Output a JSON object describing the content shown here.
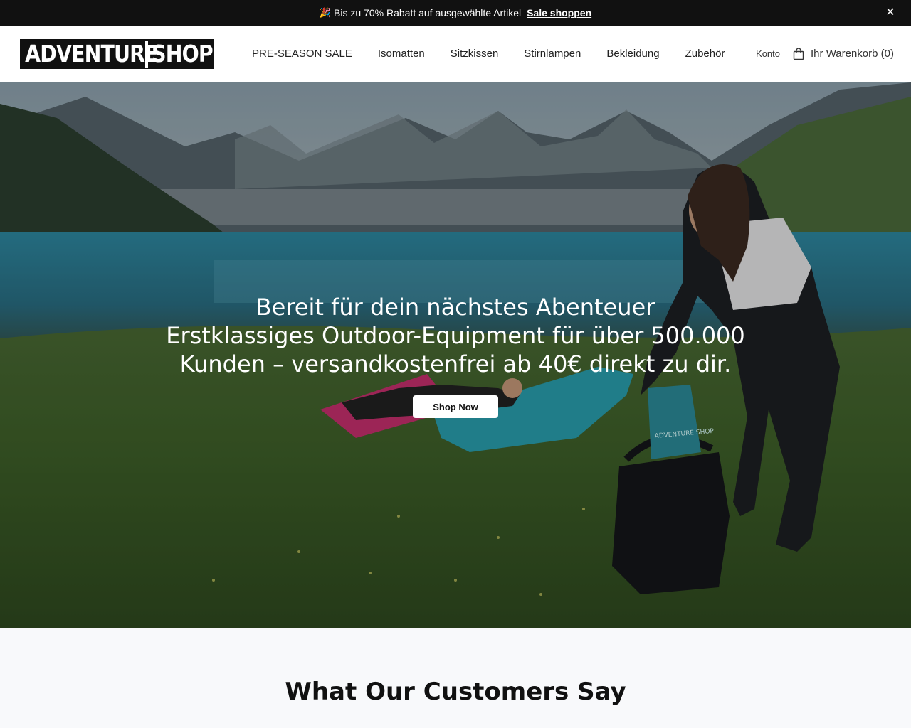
{
  "announcement": {
    "icon": "party-popper-icon",
    "text": "Bis zu 70% Rabatt auf ausgewählte Artikel",
    "link_label": "Sale shoppen",
    "close_icon": "close-icon"
  },
  "header": {
    "logo_left": "ADVENTURE",
    "logo_right": "SHOP",
    "nav": [
      {
        "label": "PRE-SEASON SALE"
      },
      {
        "label": "Isomatten"
      },
      {
        "label": "Sitzkissen"
      },
      {
        "label": "Stirnlampen"
      },
      {
        "label": "Bekleidung"
      },
      {
        "label": "Zubehör"
      }
    ],
    "account_label": "Konto",
    "cart_label": "Ihr Warenkorb (0)",
    "cart_icon": "shopping-bag-icon"
  },
  "hero": {
    "headline": "Bereit für dein nächstes Abenteuer",
    "subline": "Erstklassiges Outdoor-Equipment für über 500.000 Kunden – versandkostenfrei ab 40€ direkt zu dir.",
    "cta_label": "Shop Now",
    "bag_print": "ADVENTURE SHOP"
  },
  "reviews": {
    "title": "What Our Customers Say"
  },
  "colors": {
    "bar_bg": "#111111",
    "header_bg": "#ffffff",
    "section_bg": "#f8f9fb"
  }
}
